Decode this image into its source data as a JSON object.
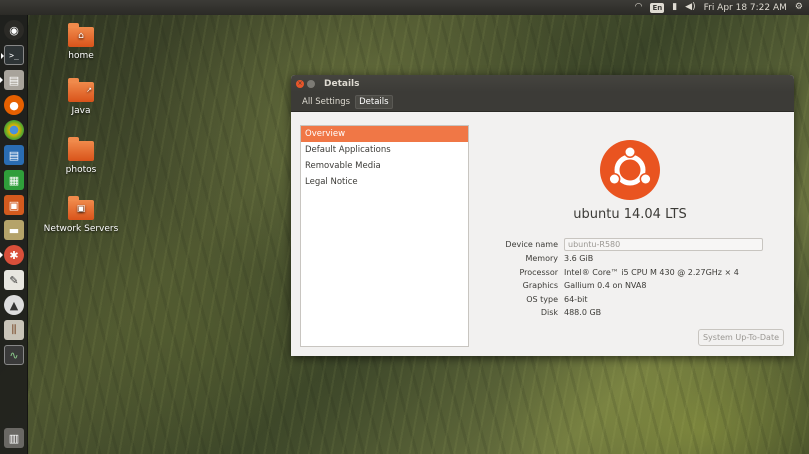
{
  "top_panel": {
    "keyboard_layout": "En",
    "clock": "Fri Apr 18  7:22 AM",
    "icons": [
      "wifi-icon",
      "keyboard-layout-icon",
      "battery-icon",
      "volume-icon",
      "gear-icon"
    ]
  },
  "launcher": {
    "items": [
      {
        "name": "dash-home-icon"
      },
      {
        "name": "terminal-icon"
      },
      {
        "name": "files-icon"
      },
      {
        "name": "firefox-icon"
      },
      {
        "name": "chromium-icon"
      },
      {
        "name": "writer-icon"
      },
      {
        "name": "calc-icon"
      },
      {
        "name": "impress-icon"
      },
      {
        "name": "archive-manager-icon"
      },
      {
        "name": "system-settings-icon"
      },
      {
        "name": "text-editor-icon"
      },
      {
        "name": "software-updater-icon"
      },
      {
        "name": "mixer-icon"
      },
      {
        "name": "system-monitor-icon"
      },
      {
        "name": "trash-icon"
      }
    ]
  },
  "desktop": {
    "icons": [
      {
        "label": "home"
      },
      {
        "label": "Java"
      },
      {
        "label": "photos"
      },
      {
        "label": "Network Servers"
      }
    ]
  },
  "window": {
    "title": "Details",
    "breadcrumbs": [
      "All Settings",
      "Details"
    ],
    "nav": [
      "Overview",
      "Default Applications",
      "Removable Media",
      "Legal Notice"
    ],
    "selected_nav": "Overview",
    "distro": "ubuntu 14.04 LTS",
    "device_name_label": "Device name",
    "device_name_value": "ubuntu-R580",
    "specs": [
      {
        "label": "Memory",
        "value": "3.6 GiB"
      },
      {
        "label": "Processor",
        "value": "Intel® Core™ i5 CPU M 430 @ 2.27GHz × 4"
      },
      {
        "label": "Graphics",
        "value": "Gallium 0.4 on NVA8"
      },
      {
        "label": "OS type",
        "value": "64-bit"
      },
      {
        "label": "Disk",
        "value": "488.0 GB"
      }
    ],
    "update_button": "System Up-To-Date",
    "accent_color": "#e95420"
  }
}
